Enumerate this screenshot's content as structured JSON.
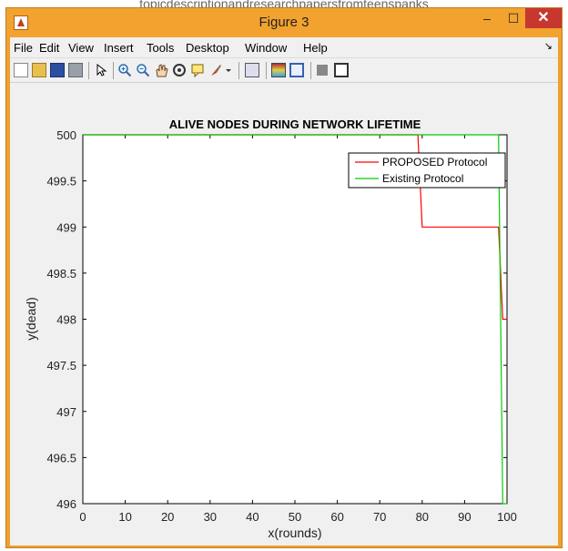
{
  "page": {
    "top_text": "topicdescriptionandresearchpapersfromteenspanks"
  },
  "window": {
    "title": "Figure 3",
    "controls": {
      "minimize": "–",
      "maximize": "☐",
      "close": "✕"
    }
  },
  "menu": {
    "items": [
      "File",
      "Edit",
      "View",
      "Insert",
      "Tools",
      "Desktop",
      "Window",
      "Help"
    ],
    "overflow": "↘"
  },
  "toolbar": {
    "icons": [
      "new-figure-icon",
      "open-file-icon",
      "save-icon",
      "print-icon",
      "pointer-icon",
      "zoom-in-icon",
      "zoom-out-icon",
      "pan-icon",
      "rotate-3d-icon",
      "data-cursor-icon",
      "brush-icon",
      "brush-dropdown-icon",
      "link-plot-icon",
      "colorbar-icon",
      "legend-icon",
      "hide-plot-tools-icon",
      "show-plot-tools-icon"
    ]
  },
  "colors": {
    "series1": "#ff0000",
    "series2": "#00cc00",
    "titlebar": "#f2a22e",
    "close": "#c7372f"
  },
  "chart_data": {
    "type": "line",
    "title": "ALIVE NODES DURING NETWORK LIFETIME",
    "xlabel": "x(rounds)",
    "ylabel": "y(dead)",
    "xlim": [
      0,
      100
    ],
    "ylim": [
      496,
      500
    ],
    "xticks": [
      "0",
      "10",
      "20",
      "30",
      "40",
      "50",
      "60",
      "70",
      "80",
      "90",
      "100"
    ],
    "yticks": [
      "496",
      "496.5",
      "497",
      "497.5",
      "498",
      "498.5",
      "499",
      "499.5",
      "500"
    ],
    "legend_position": "top-right",
    "grid": false,
    "series": [
      {
        "name": "PROPOSED Protocol",
        "x": [
          0,
          79,
          80,
          98,
          99,
          100
        ],
        "y": [
          500,
          500,
          499,
          499,
          498,
          498
        ]
      },
      {
        "name": "Existing Protocol",
        "x": [
          0,
          98,
          99,
          100
        ],
        "y": [
          500,
          500,
          496,
          496
        ]
      }
    ]
  }
}
